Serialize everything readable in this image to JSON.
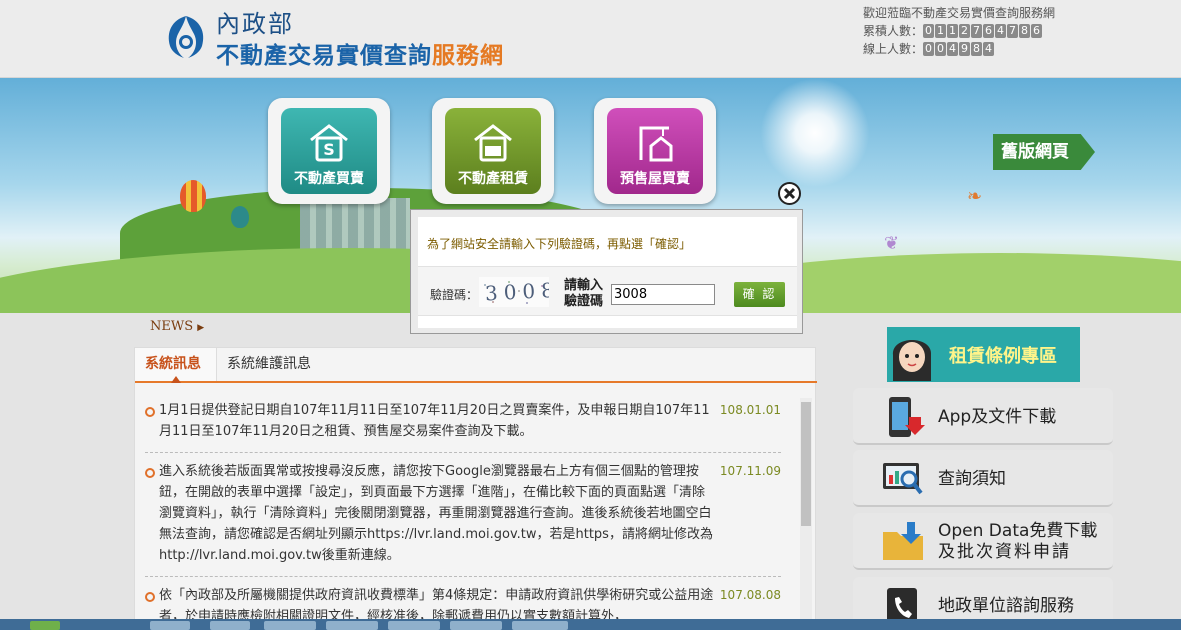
{
  "header": {
    "org": "內政部",
    "title_main": "不動產交易實價查詢",
    "title_accent": "服務網",
    "welcome": "歡迎蒞臨不動產交易實價查詢服務網",
    "total_label": "累積人數：",
    "total_digits": [
      "0",
      "1",
      "1",
      "2",
      "7",
      "6",
      "4",
      "7",
      "8",
      "6"
    ],
    "online_label": "線上人數：",
    "online_digits": [
      "0",
      "0",
      "4",
      "9",
      "8",
      "4"
    ]
  },
  "banner": {
    "categories": [
      {
        "label": "不動產買賣",
        "icon": "house-dollar-icon",
        "color": "#2aa6a1"
      },
      {
        "label": "不動產租賃",
        "icon": "house-for-rent-icon",
        "color": "#76a02c"
      },
      {
        "label": "預售屋買賣",
        "icon": "crane-house-icon",
        "color": "#c03ca8"
      }
    ],
    "old_version": "舊版網頁"
  },
  "news": {
    "label": "NEWS",
    "tabs": [
      "系統訊息",
      "系統維護訊息"
    ],
    "items": [
      {
        "text": "1月1日提供登記日期自107年11月11日至107年11月20日之買賣案件，及申報日期自107年11月11日至107年11月20日之租賃、預售屋交易案件查詢及下載。",
        "date": "108.01.01"
      },
      {
        "text": "進入系統後若版面異常或按搜尋沒反應，請您按下Google瀏覽器最右上方有個三個點的管理按鈕，在開啟的表單中選擇「設定」，到頁面最下方選擇「進階」，在備比較下面的頁面點選「清除瀏覽資料」，執行「清除資料」完後關閉瀏覽器，再重開瀏覽器進行查詢。進後系統後若地圖空白無法查詢，請您確認是否網址列顯示https://lvr.land.moi.gov.tw，若是https，請將網址修改為http://lvr.land.moi.gov.tw後重新連線。",
        "date": "107.11.09"
      },
      {
        "text": "依「內政部及所屬機關提供政府資訊收費標準」第4條規定：申請政府資訊供學術研究或公益用途者，於申請時應檢附相關證明文件，經核准後，除郵遞費用仍以實支數額計算外，",
        "date": "107.08.08"
      }
    ]
  },
  "sidebar": {
    "rental_banner": "租賃條例專區",
    "buttons": [
      {
        "label_lines": [
          "App及文件下載"
        ],
        "icon": "mobile-download-icon"
      },
      {
        "label_lines": [
          "查詢須知"
        ],
        "icon": "monitor-search-icon"
      },
      {
        "label_lines": [
          "Open Data免費下載",
          "及批次資料申請"
        ],
        "icon": "folder-download-icon"
      },
      {
        "label_lines": [
          "地政單位諮詢服務"
        ],
        "icon": "phone-book-icon"
      }
    ]
  },
  "modal": {
    "message": "為了網站安全請輸入下列驗證碼，再點選「確認」",
    "captcha_label": "驗證碼：",
    "captcha_text": "3008",
    "enter_label_line1": "請輸入",
    "enter_label_line2": "驗證碼",
    "input_value": "3008",
    "confirm_label": "確 認"
  }
}
